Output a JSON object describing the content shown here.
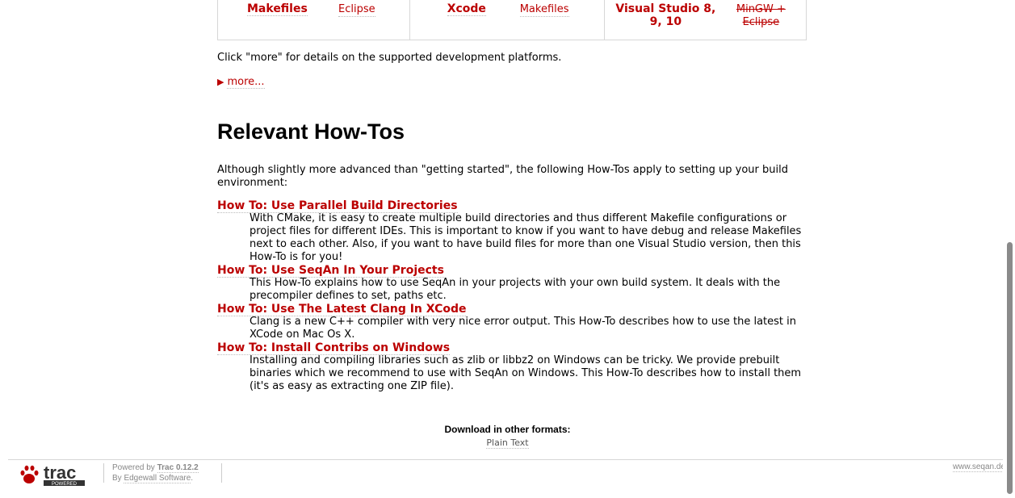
{
  "platforms": {
    "cells": [
      {
        "main": "Makefiles",
        "alt": "Eclipse",
        "alt_strike": false
      },
      {
        "main": "Xcode",
        "alt": "Makefiles",
        "alt_strike": false
      },
      {
        "main": "Visual Studio 8, 9, 10",
        "alt": "MinGW + Eclipse",
        "alt_strike": true
      }
    ]
  },
  "intro": {
    "more_text": "Click \"more\" for details on the supported development platforms.",
    "more_link": "more..."
  },
  "howtos": {
    "heading": "Relevant How-Tos",
    "intro": "Although slightly more advanced than \"getting started\", the following How-Tos apply to setting up your build environment:",
    "items": [
      {
        "title": "How To: Use Parallel Build Directories",
        "desc": "With CMake, it is easy to create multiple build directories and thus different Makefile configurations or project files for different IDEs. This is important to know if you want to have debug and release Makefiles next to each other. Also, if you want to have build files for more than one Visual Studio version, then this How-To is for you!"
      },
      {
        "title": "How To: Use SeqAn In Your Projects",
        "desc": "This How-To explains how to use SeqAn in your projects with your own build system. It deals with the precompiler defines to set, paths etc."
      },
      {
        "title": "How To: Use The Latest Clang In XCode",
        "desc": "Clang is a new C++ compiler with very nice error output. This How-To describes how to use the latest in XCode on Mac Os X."
      },
      {
        "title": "How To: Install Contribs on Windows",
        "desc": "Installing and compiling libraries such as zlib or libbz2 on Windows can be tricky. We provide prebuilt binaries which we recommend to use with SeqAn on Windows. This How-To describes how to install them (it's as easy as extracting one ZIP file)."
      }
    ]
  },
  "download": {
    "label": "Download in other formats:",
    "plain_text": "Plain Text"
  },
  "footer": {
    "logo_text": "trac",
    "logo_sub": "POWERED",
    "powered_prefix": "Powered by ",
    "trac_version": "Trac 0.12.2",
    "by_prefix": "By ",
    "by_link": "Edgewall Software",
    "by_suffix": ".",
    "site": "www.seqan.de"
  },
  "colors": {
    "link": "#bb0000"
  }
}
